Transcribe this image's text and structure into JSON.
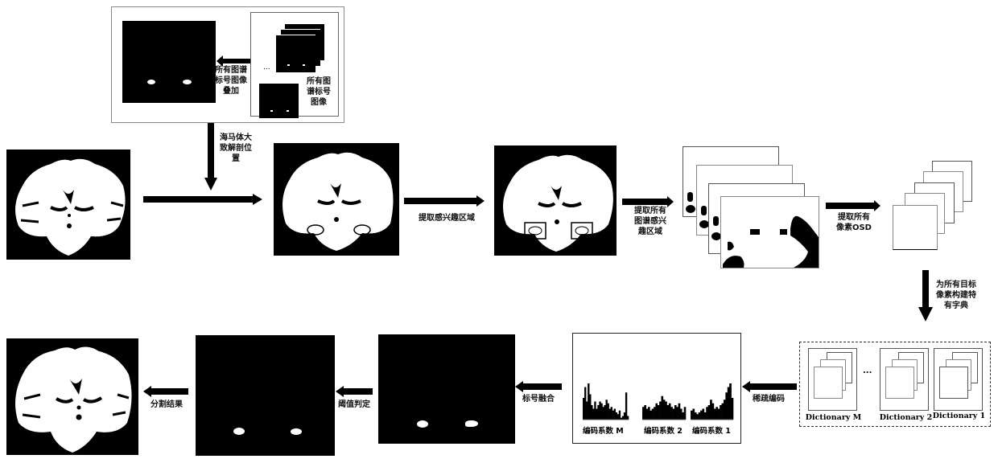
{
  "diagram": {
    "description": "Hippocampus segmentation pipeline with sparse coding over atlas dictionaries",
    "atlas_panel": {
      "superposition_label": "所有图谱\n标号图像\n叠加",
      "atlas_labels_label": "所有图\n谱标号\n图像",
      "ellipsis": "..."
    },
    "steps": {
      "anatomical_position": "海马体大\n致解剖位\n置",
      "extract_roi": "提取感兴趣区域",
      "extract_atlas_roi": "提取所有\n图谱感兴\n趣区域",
      "extract_osd": "提取所有\n像素OSD",
      "build_dictionary": "为所有目标\n像素构建特\n有字典",
      "sparse_coding": "稀疏编码",
      "label_fusion": "标号融合",
      "threshold": "阈值判定",
      "segmentation_result": "分割结果"
    },
    "dictionaries": [
      {
        "label": "Dictionary M"
      },
      {
        "label": "Dictionary 2"
      },
      {
        "label": "Dictionary 1"
      }
    ],
    "dictionary_ellipsis": "...",
    "coefficients": [
      {
        "label": "编码系数 M",
        "values": [
          0.6,
          0.9,
          0.5,
          1.0,
          0.7,
          0.4,
          0.3,
          0.5,
          0.3,
          0.4,
          0.5,
          0.45,
          0.35,
          0.4,
          0.55,
          0.45,
          0.3,
          0.35,
          0.25,
          0.3,
          0.2,
          0.15,
          0.25,
          0.05,
          0.1,
          0.2,
          0.75,
          0.1
        ]
      },
      {
        "label": "编码系数 2",
        "values": [
          0.35,
          0.4,
          0.3,
          0.35,
          0.25,
          0.3,
          0.35,
          0.45,
          0.4,
          0.5,
          0.65,
          0.55,
          0.5,
          0.4,
          0.45,
          0.35,
          0.3,
          0.4,
          0.35,
          0.45,
          0.3,
          0.2,
          0.35
        ]
      },
      {
        "label": "编码系数 1",
        "values": [
          0.25,
          0.3,
          0.2,
          0.15,
          0.2,
          0.25,
          0.3,
          0.2,
          0.35,
          0.4,
          0.55,
          0.45,
          0.3,
          0.35,
          0.3,
          0.4,
          0.45,
          0.55,
          0.75,
          0.9,
          1.0,
          0.6
        ]
      }
    ]
  }
}
